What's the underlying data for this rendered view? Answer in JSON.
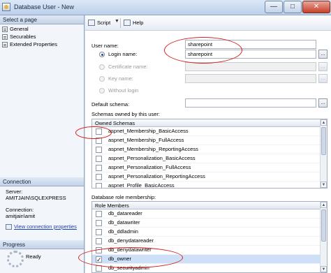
{
  "window": {
    "title": "Database User - New"
  },
  "left_pane": {
    "select_page_header": "Select a page",
    "pages": [
      {
        "label": "General"
      },
      {
        "label": "Securables"
      },
      {
        "label": "Extended Properties"
      }
    ],
    "connection_header": "Connection",
    "server_label": "Server:",
    "server_value": "AMITJAIN\\SQLEXPRESS",
    "connection_label": "Connection:",
    "connection_value": "amitjain\\amit",
    "view_connection_link": "View connection properties",
    "progress_header": "Progress",
    "progress_status": "Ready"
  },
  "toolbar": {
    "script_label": "Script",
    "help_label": "Help"
  },
  "form": {
    "user_name_label": "User name:",
    "user_name_value": "sharepoint",
    "login_name_label": "Login name:",
    "login_name_value": "sharepoint",
    "certificate_name_label": "Certificate name:",
    "key_name_label": "Key name:",
    "without_login_label": "Without login",
    "default_schema_label": "Default schema:",
    "browse_label": "...",
    "selected_option": "login_name"
  },
  "schemas": {
    "section_label": "Schemas owned by this user:",
    "column_header": "Owned Schemas",
    "rows": [
      {
        "name": "aspnet_Membership_BasicAccess",
        "checked": false
      },
      {
        "name": "aspnet_Membership_FullAccess",
        "checked": false
      },
      {
        "name": "aspnet_Membership_ReportingAccess",
        "checked": false
      },
      {
        "name": "aspnet_Personalization_BasicAccess",
        "checked": false
      },
      {
        "name": "aspnet_Personalization_FullAccess",
        "checked": false
      },
      {
        "name": "aspnet_Personalization_ReportingAccess",
        "checked": false
      },
      {
        "name": "aspnet_Profile_BasicAccess",
        "checked": false
      }
    ]
  },
  "roles": {
    "section_label": "Database role membership:",
    "column_header": "Role Members",
    "rows": [
      {
        "name": "db_datareader",
        "checked": false
      },
      {
        "name": "db_datawriter",
        "checked": false
      },
      {
        "name": "db_ddladmin",
        "checked": false
      },
      {
        "name": "db_denydatareader",
        "checked": false
      },
      {
        "name": "db_denydatawriter",
        "checked": false
      },
      {
        "name": "db_owner",
        "checked": true
      },
      {
        "name": "db_securityadmin",
        "checked": false
      }
    ]
  },
  "colors": {
    "annotation": "#d4201a",
    "selected_row": "#cde0f7",
    "link": "#1a3fb5"
  }
}
